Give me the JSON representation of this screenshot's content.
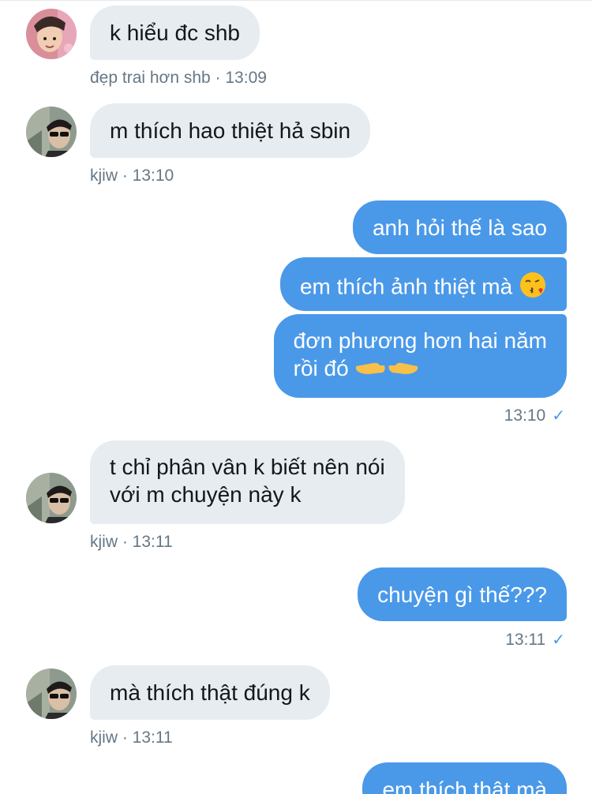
{
  "messages": [
    {
      "side": "in",
      "text": "k hiểu đc shb",
      "sender": "đẹp trai hơn shb",
      "time": "13:09",
      "avatar": "avatar-shb"
    },
    {
      "side": "in",
      "text": "m thích hao thiệt hả sbin",
      "sender": "kjiw",
      "time": "13:10",
      "avatar": "avatar-kjiw"
    },
    {
      "side": "out",
      "text": "anh hỏi thế là sao"
    },
    {
      "side": "out",
      "text": "em thích ảnh thiệt mà",
      "emoji": "kissing-face-icon"
    },
    {
      "side": "out",
      "lines": [
        "đơn phương hơn hai năm",
        "rồi đó"
      ],
      "emoji": "pointing-hands-icon",
      "time": "13:10",
      "status": "✓"
    },
    {
      "side": "in",
      "lines": [
        "t chỉ phân vân k biết nên nói",
        "với m chuyện này k"
      ],
      "sender": "kjiw",
      "time": "13:11",
      "avatar": "avatar-kjiw"
    },
    {
      "side": "out",
      "text": "chuyện gì thế???",
      "time": "13:11",
      "status": "✓"
    },
    {
      "side": "in",
      "text": "mà thích thật đúng k",
      "sender": "kjiw",
      "time": "13:11",
      "avatar": "avatar-kjiw"
    },
    {
      "side": "out",
      "text": "em thích thật mà"
    }
  ],
  "meta": {
    "sep": " · "
  },
  "colors": {
    "incoming_bubble": "#e6ecf0",
    "outgoing_bubble": "#4a99e9",
    "meta_text": "#657786",
    "read_check": "#4a99e9"
  }
}
